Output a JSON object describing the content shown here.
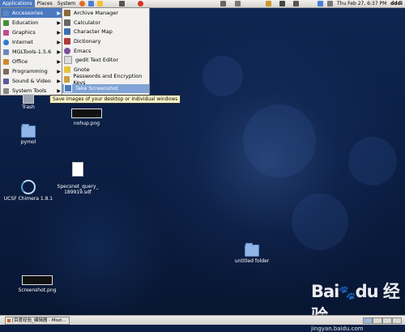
{
  "top_panel": {
    "menus": [
      "Applications",
      "Places",
      "System"
    ],
    "clock": "Thu Feb 27,  6:37 PM",
    "user": "dddi",
    "launcher_colors": [
      "#e46c24",
      "#4a7fd6",
      "#f2c230",
      "#7aa23c",
      "#d7322a"
    ]
  },
  "app_menu": {
    "items": [
      {
        "label": "Accessories",
        "icon": "accessories-icon",
        "color": "#5b87c7"
      },
      {
        "label": "Education",
        "icon": "education-icon",
        "color": "#3f8f3a"
      },
      {
        "label": "Graphics",
        "icon": "graphics-icon",
        "color": "#c04a8c"
      },
      {
        "label": "Internet",
        "icon": "internet-icon",
        "color": "#2f7ad0"
      },
      {
        "label": "MGLTools-1.5.6",
        "icon": "mgltools-icon",
        "color": "#6b88b8"
      },
      {
        "label": "Office",
        "icon": "office-icon",
        "color": "#d08a2a"
      },
      {
        "label": "Programming",
        "icon": "programming-icon",
        "color": "#7a6a5a"
      },
      {
        "label": "Sound & Video",
        "icon": "sound-video-icon",
        "color": "#5a5a9a"
      },
      {
        "label": "System Tools",
        "icon": "system-tools-icon",
        "color": "#8a8a8a"
      }
    ],
    "arrow": "▶"
  },
  "sub_menu": {
    "items": [
      {
        "label": "Archive Manager",
        "icon": "archive-manager-icon",
        "color": "#8c6a3c"
      },
      {
        "label": "Calculator",
        "icon": "calculator-icon",
        "color": "#666666"
      },
      {
        "label": "Character Map",
        "icon": "character-map-icon",
        "color": "#3a6fb0"
      },
      {
        "label": "Dictionary",
        "icon": "dictionary-icon",
        "color": "#b03a3a"
      },
      {
        "label": "Emacs",
        "icon": "emacs-icon",
        "color": "#7a4fa0"
      },
      {
        "label": "gedit Text Editor",
        "icon": "gedit-icon",
        "color": "#dddddd"
      },
      {
        "label": "Gnote",
        "icon": "gnote-icon",
        "color": "#e8c23a"
      },
      {
        "label": "Passwords and Encryption Keys",
        "icon": "keys-icon",
        "color": "#c9a23a"
      },
      {
        "label": "Take Screenshot",
        "icon": "screenshot-icon",
        "color": "#4a78c0"
      }
    ]
  },
  "tooltip": "Save images of your desktop or individual windows",
  "desktop_icons": {
    "trash": "Trash",
    "nohup": "nohup.png",
    "pymol": "pymol",
    "specsnet": "Specsnet_query_\n189919.sdf",
    "chimera": "UCSF Chimera 1.8.1",
    "untitled": "untitled folder",
    "screenshot": "Screenshot.png"
  },
  "bottom_panel": {
    "task": "[百度经验_编辑器 - Mozi..."
  },
  "watermark": {
    "logo": "Bai⁠du 经验",
    "url": "jingyan.baidu.com"
  }
}
